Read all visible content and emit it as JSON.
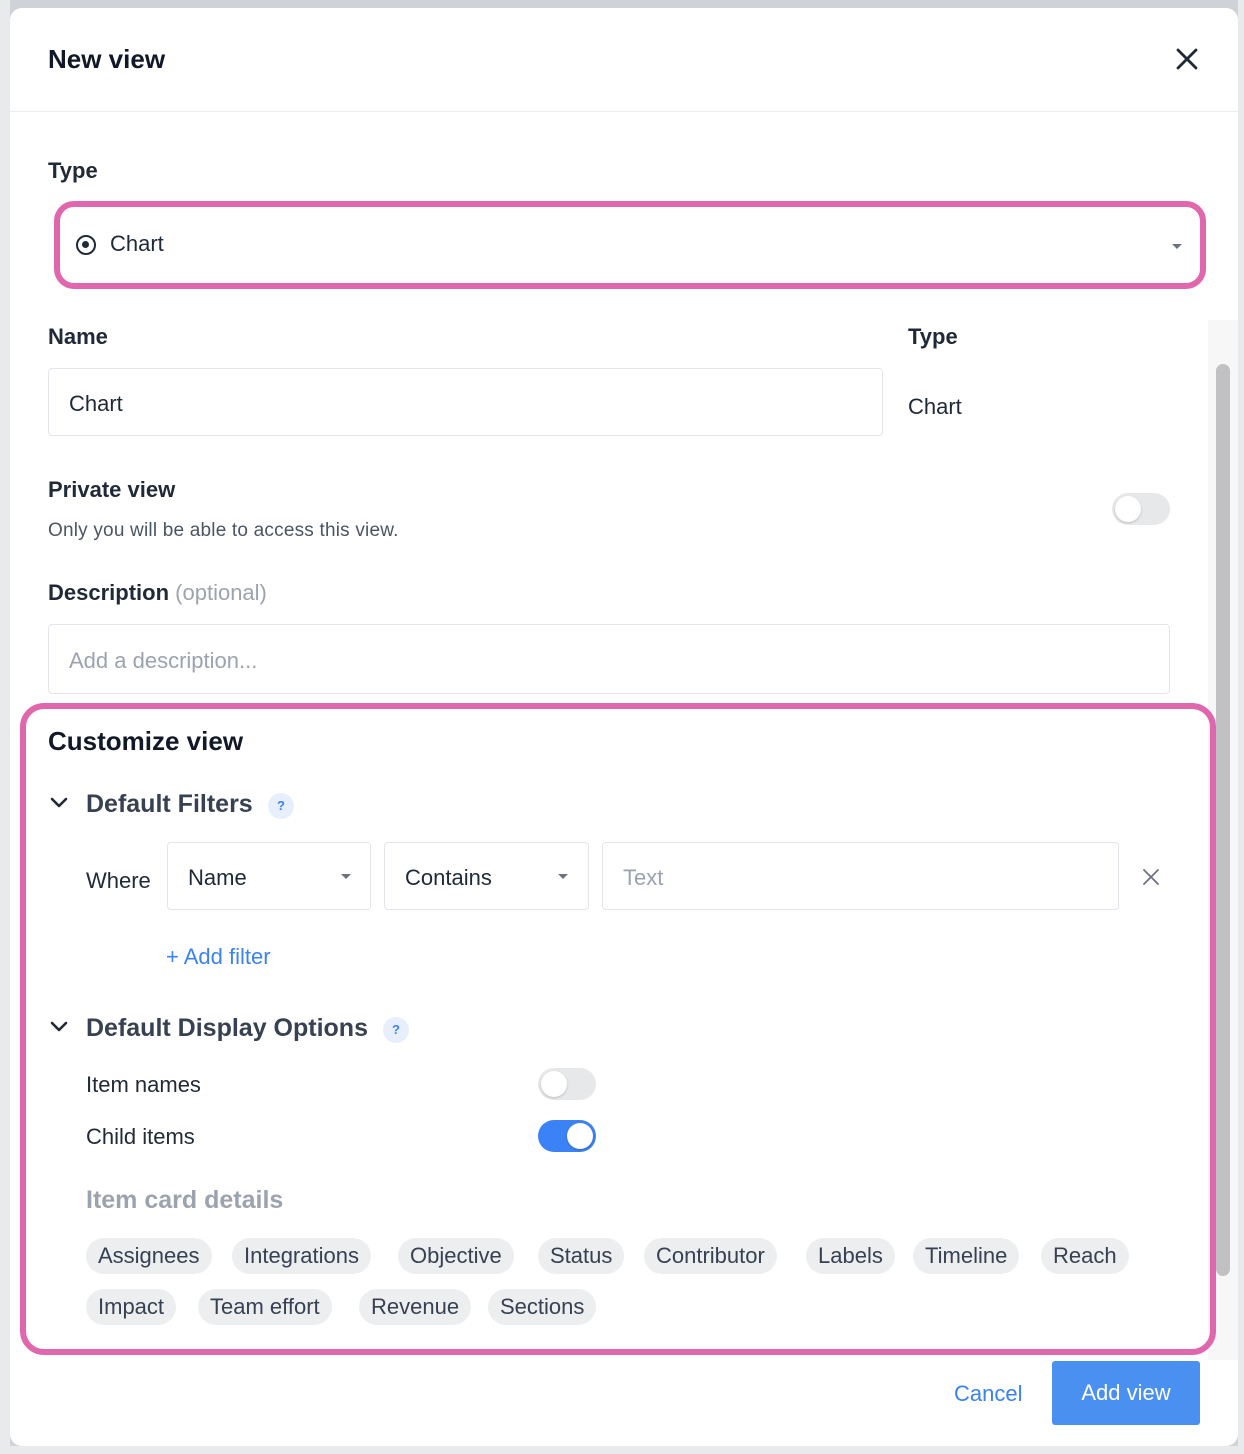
{
  "modal": {
    "title": "New view",
    "close_icon": "close-icon"
  },
  "type_field": {
    "label": "Type",
    "selected_value": "Chart",
    "icon": "radio-selected-icon"
  },
  "name_field": {
    "label": "Name",
    "value": "Chart"
  },
  "type_display": {
    "label": "Type",
    "value": "Chart"
  },
  "private_view": {
    "label": "Private view",
    "help": "Only you will be able to access this view.",
    "enabled": false
  },
  "description": {
    "label": "Description",
    "optional": "(optional)",
    "placeholder": "Add a description..."
  },
  "customize": {
    "title": "Customize view",
    "filters": {
      "heading": "Default Filters",
      "help_icon": "?",
      "where_label": "Where",
      "field": "Name",
      "operator": "Contains",
      "value_placeholder": "Text",
      "add_filter_label": "+ Add filter"
    },
    "display": {
      "heading": "Default Display Options",
      "help_icon": "?",
      "item_names_label": "Item names",
      "item_names_enabled": false,
      "child_items_label": "Child items",
      "child_items_enabled": true,
      "card_details_label": "Item card details",
      "chips": [
        "Assignees",
        "Integrations",
        "Objective",
        "Status",
        "Contributor",
        "Labels",
        "Timeline",
        "Reach",
        "Impact",
        "Team effort",
        "Revenue",
        "Sections"
      ]
    }
  },
  "footer": {
    "cancel_label": "Cancel",
    "add_label": "Add view"
  },
  "colors": {
    "accent": "#3b82f6",
    "highlight": "#e067ad"
  }
}
